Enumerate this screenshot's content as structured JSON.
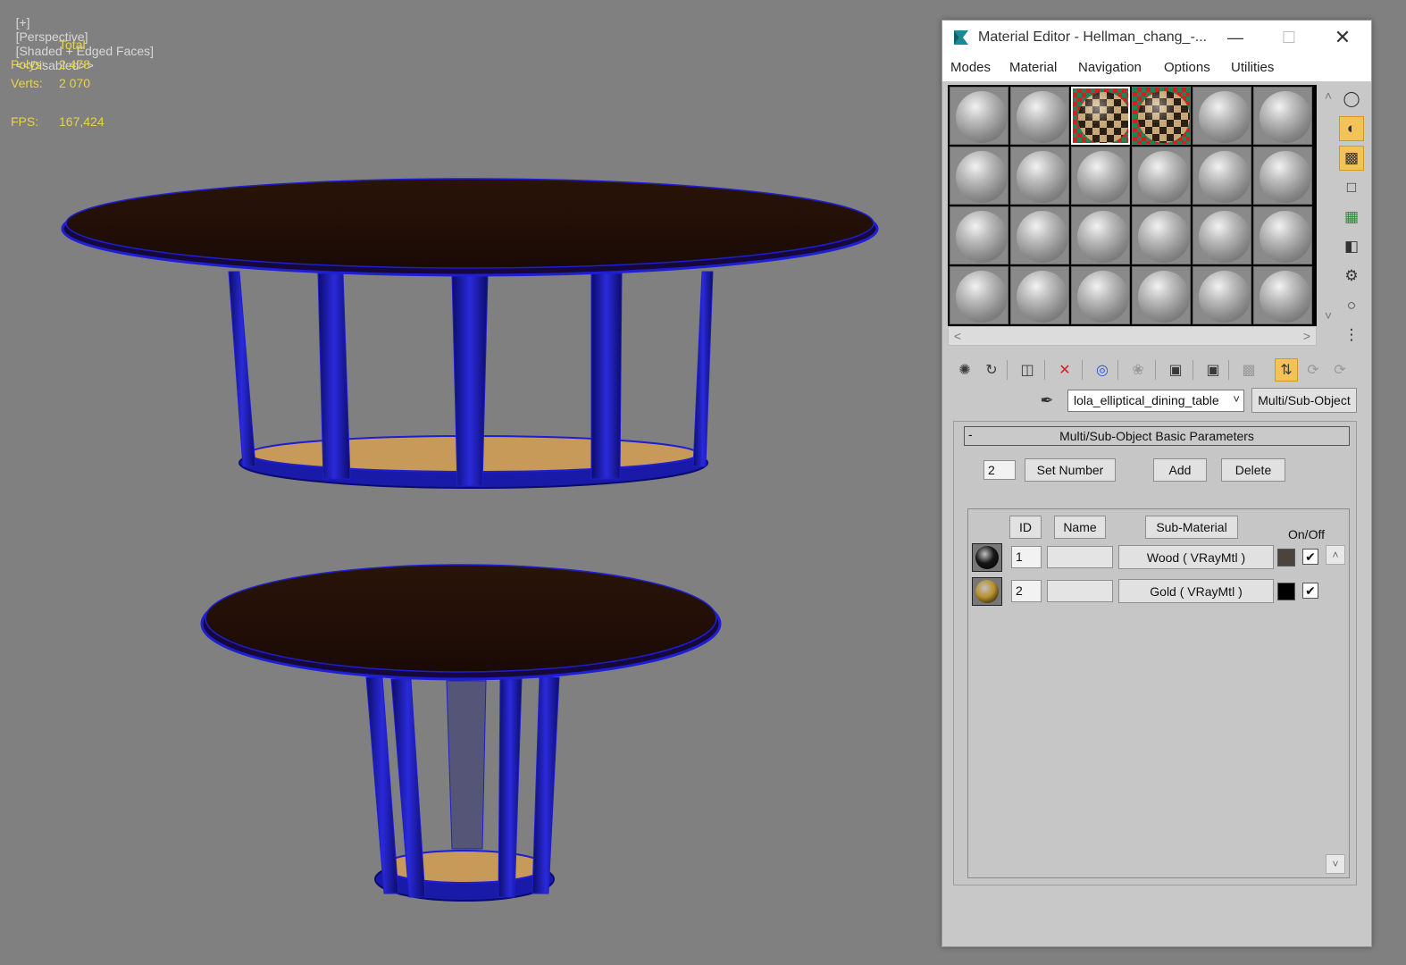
{
  "viewport": {
    "label_segments": [
      "[+]",
      "[Perspective]",
      "[Shaded + Edged Faces]",
      "<<Disabled>>"
    ],
    "stats": {
      "header": "Total",
      "polys_label": "Polys:",
      "polys_value": "2 478",
      "verts_label": "Verts:",
      "verts_value": "2 070",
      "fps_label": "FPS:",
      "fps_value": "167,424"
    },
    "colors": {
      "background": "#808080",
      "wire": "#1e1ed2",
      "table_top": "#241008",
      "base_disc": "#c89a5a",
      "stats_text": "#e8d24a"
    }
  },
  "material_editor": {
    "title": "Material Editor - Hellman_chang_-...",
    "menu": [
      "Modes",
      "Material",
      "Navigation",
      "Options",
      "Utilities"
    ],
    "slots": {
      "rows": 4,
      "cols": 6,
      "checker_slots": [
        2,
        3
      ],
      "selected_slot": 2
    },
    "side_toolbar_icons": [
      "sample-type-sphere-icon",
      "backlight-icon",
      "background-checker-icon",
      "sample-uv-tiling-icon",
      "video-color-check-icon",
      "make-preview-icon",
      "options-icon",
      "select-by-material-icon",
      "material-map-navigator-icon"
    ],
    "h_toolbar_icons": [
      "get-material-icon",
      "put-material-to-scene-icon",
      "assign-material-to-selection-icon",
      "reset-map-icon",
      "make-material-copy-icon",
      "make-unique-icon",
      "put-to-library-icon",
      "material-id-channel-icon",
      "show-shaded-material-in-viewport-icon",
      "show-end-result-icon",
      "go-to-parent-icon",
      "go-forward-to-sibling-icon"
    ],
    "material_name": "lola_elliptical_dining_table",
    "material_type": "Multi/Sub-Object",
    "rollout": {
      "collapse_symbol": "-",
      "title": "Multi/Sub-Object Basic Parameters",
      "set_number_value": "2",
      "set_number_label": "Set Number",
      "add_label": "Add",
      "delete_label": "Delete",
      "columns": {
        "id": "ID",
        "name": "Name",
        "sub_material": "Sub-Material",
        "on_off": "On/Off"
      },
      "sub_materials": [
        {
          "id": "1",
          "name": "",
          "material": "Wood  ( VRayMtl )",
          "color": "#4a4440",
          "ball_color": "#161616",
          "enabled": "✔"
        },
        {
          "id": "2",
          "name": "",
          "material": "Gold  ( VRayMtl )",
          "color": "#000000",
          "ball_color": "#b8902c",
          "enabled": "✔"
        }
      ]
    }
  }
}
